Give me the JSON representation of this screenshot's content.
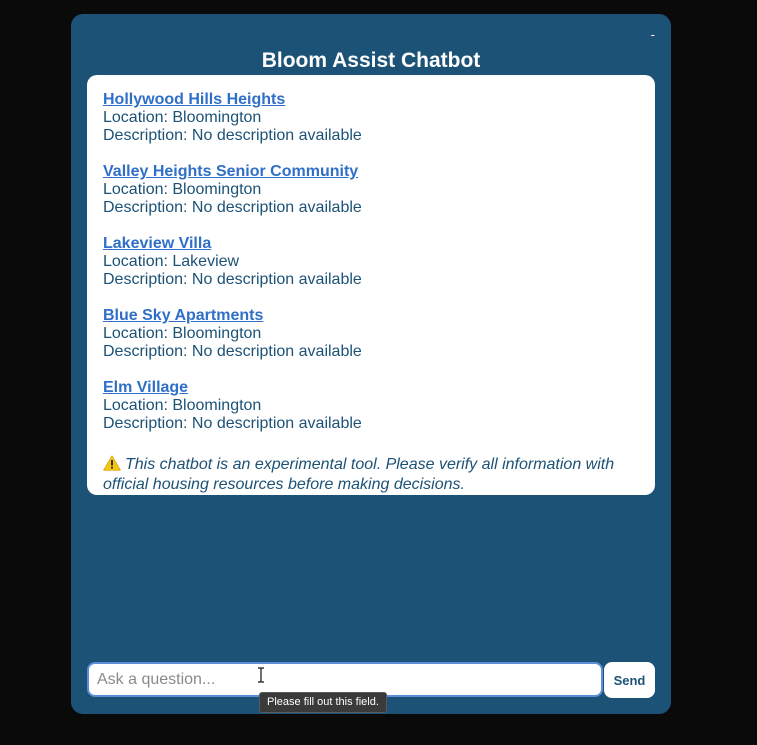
{
  "window": {
    "minimize_label": "-",
    "title": "Bloom Assist Chatbot"
  },
  "listings": [
    {
      "name": "Hollywood Hills Heights",
      "location": "Location: Bloomington",
      "description": "Description: No description available"
    },
    {
      "name": "Valley Heights Senior Community",
      "location": "Location: Bloomington",
      "description": "Description: No description available"
    },
    {
      "name": "Lakeview Villa",
      "location": "Location: Lakeview",
      "description": "Description: No description available"
    },
    {
      "name": "Blue Sky Apartments",
      "location": "Location: Bloomington",
      "description": "Description: No description available"
    },
    {
      "name": "Elm Village",
      "location": "Location: Bloomington",
      "description": "Description: No description available"
    }
  ],
  "disclaimer": {
    "icon": "warning-icon",
    "text": "This chatbot is an experimental tool. Please verify all information with official housing resources before making decisions."
  },
  "input": {
    "value": "",
    "placeholder": "Ask a question...",
    "send_label": "Send",
    "validation_tooltip": "Please fill out this field."
  },
  "colors": {
    "window_bg": "#1c5276",
    "page_bg": "#0a0a0a",
    "link": "#2f6fc8",
    "text": "#1c5276",
    "input_border": "#5b8fd6"
  }
}
